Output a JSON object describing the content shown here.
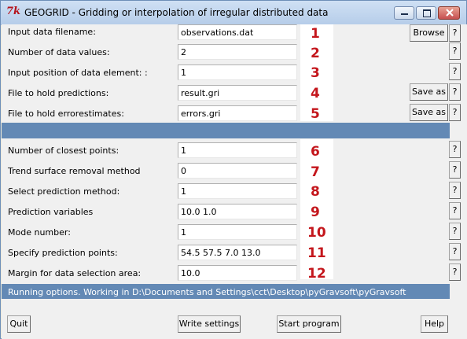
{
  "window": {
    "title": "GEOGRID - Gridding or interpolation of irregular distributed data",
    "logo": "7k",
    "controls": [
      "minimize-icon",
      "maximize-icon",
      "close-icon"
    ]
  },
  "rows": [
    {
      "label": "Input data filename:",
      "value": "observations.dat",
      "number": "1",
      "button": "Browse",
      "help": "?"
    },
    {
      "label": "Number of data values:",
      "value": "2",
      "number": "2",
      "help": "?"
    },
    {
      "label": "Input position of data element: :",
      "value": "1",
      "number": "3",
      "help": "?"
    },
    {
      "label": "File to hold predictions:",
      "value": "result.gri",
      "number": "4",
      "button": "Save as",
      "help": "?"
    },
    {
      "label": "File to hold errorestimates:",
      "value": "errors.gri",
      "number": "5",
      "button": "Save as",
      "help": "?"
    },
    {
      "label": "Number of closest points:",
      "value": "1",
      "number": "6",
      "help": "?"
    },
    {
      "label": "Trend surface removal method",
      "value": "0",
      "number": "7",
      "help": "?"
    },
    {
      "label": "Select prediction method:",
      "value": "1",
      "number": "8",
      "help": "?"
    },
    {
      "label": "Prediction variables",
      "value": "10.0 1.0",
      "number": "9",
      "help": "?"
    },
    {
      "label": "Mode  number:",
      "value": "1",
      "number": "10",
      "help": "?"
    },
    {
      "label": "Specify prediction points:",
      "value": "54.5 57.5 7.0 13.0",
      "number": "11",
      "help": "?"
    },
    {
      "label": "Margin for data selection area:",
      "value": "10.0",
      "number": "12",
      "help": "?"
    }
  ],
  "status": "Running options. Working in D:\\Documents and Settings\\cct\\Desktop\\pyGravsoft\\pyGravsoft",
  "footer": {
    "quit": "Quit",
    "write": "Write settings",
    "start": "Start program",
    "help": "Help"
  },
  "colors": {
    "strip": "#6389b5",
    "number": "#c4161c"
  }
}
